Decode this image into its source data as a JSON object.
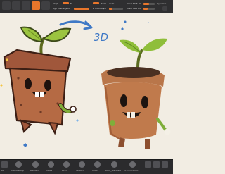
{
  "toolbar": {
    "mrgb": "Mrgb",
    "rgb": "Rgb",
    "m": "M",
    "rgb_intensity": "Rgb Intensity",
    "rgb_intensity_value": "100",
    "zadd": "Zadd",
    "zsub": "Zsub",
    "z_intensity": "Z Intensity",
    "z_intensity_value": "25",
    "focal_shift": "Focal Shift",
    "focal_shift_value": "0",
    "draw_size": "Draw Size",
    "draw_size_value": "64",
    "dynamic": "Dynamic"
  },
  "canvas": {
    "annotation": "3D"
  },
  "bottombar": {
    "items": [
      "DL",
      "ClayBuildup",
      "Standard",
      "Move",
      "Pinch",
      "hPolish",
      "Inflat",
      "Dam_Standard",
      "TrimDynamic"
    ]
  },
  "colors": {
    "accent": "#e8762b",
    "annotation_blue": "#3f79c6"
  }
}
